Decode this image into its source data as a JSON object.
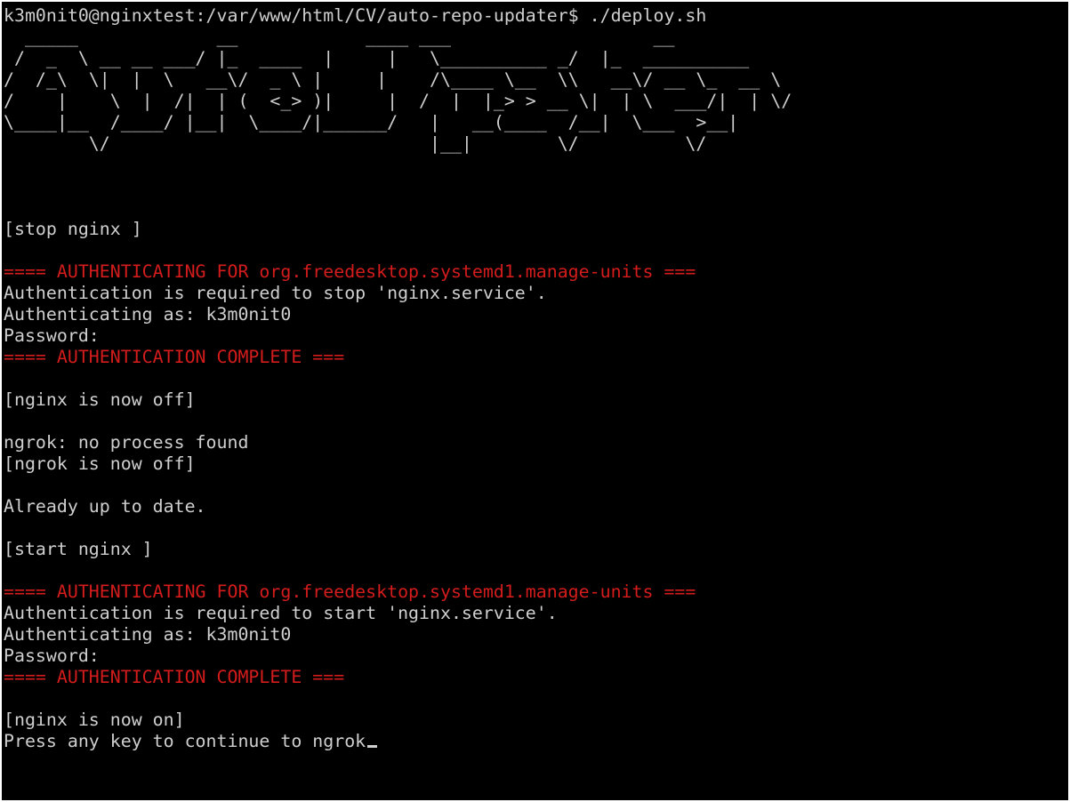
{
  "window": {
    "title": "k3m0nit0@nginxtest"
  },
  "colors": {
    "background": "#000000",
    "text": "#cfcfcf",
    "auth_header": "#d41c1c"
  },
  "terminal": {
    "prompt_command": "k3m0nit0@nginxtest:/var/www/html/CV/auto-repo-updater$ ./deploy.sh",
    "banner": [
      "  _____             __            ____ ___                   __",
      " /  _  \\ __ __ ___/ |_  ____  |     |   \\__________ _/  |_  __________",
      "/  /_\\  \\|  |  \\   __\\/  _ \\ |     |    /\\____ \\__  \\\\   __\\/ __ \\_  __ \\",
      "/    |    \\  |  /|  | (  <_> )|     |  /  |  |_> > __ \\|  | \\  ___/|  | \\/",
      "\\____|__  /____/ |__|  \\____/|______/   |   __(____  /__|  \\___  >__|",
      "        \\/                              |__|        \\/          \\/"
    ],
    "stop_nginx": "[stop nginx ]",
    "auth1_header": "==== AUTHENTICATING FOR org.freedesktop.systemd1.manage-units ===",
    "auth1_required": "Authentication is required to stop 'nginx.service'.",
    "auth1_as": "Authenticating as: k3m0nit0",
    "auth1_password": "Password:",
    "auth1_complete": "==== AUTHENTICATION COMPLETE ===",
    "nginx_off": "[nginx is now off]",
    "ngrok_no_process": "ngrok: no process found",
    "ngrok_off": "[ngrok is now off]",
    "git_status": "Already up to date.",
    "start_nginx": "[start nginx ]",
    "auth2_header": "==== AUTHENTICATING FOR org.freedesktop.systemd1.manage-units ===",
    "auth2_required": "Authentication is required to start 'nginx.service'.",
    "auth2_as": "Authenticating as: k3m0nit0",
    "auth2_password": "Password:",
    "auth2_complete": "==== AUTHENTICATION COMPLETE ===",
    "nginx_on": "[nginx is now on]",
    "continue_prompt": "Press any key to continue to ngrok"
  }
}
